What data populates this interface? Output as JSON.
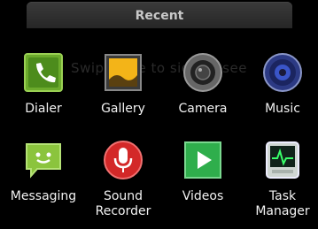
{
  "header": {
    "title": "Recent"
  },
  "hint": "Swipe side to side to see",
  "apps": [
    {
      "label": "Dialer",
      "icon": "phone-icon"
    },
    {
      "label": "Gallery",
      "icon": "picture-icon"
    },
    {
      "label": "Camera",
      "icon": "camera-icon"
    },
    {
      "label": "Music",
      "icon": "speaker-icon"
    },
    {
      "label": "Messaging",
      "icon": "chat-icon"
    },
    {
      "label": "Sound\nRecorder",
      "icon": "microphone-icon"
    },
    {
      "label": "Videos",
      "icon": "play-icon"
    },
    {
      "label": "Task\nManager",
      "icon": "monitor-icon"
    }
  ]
}
